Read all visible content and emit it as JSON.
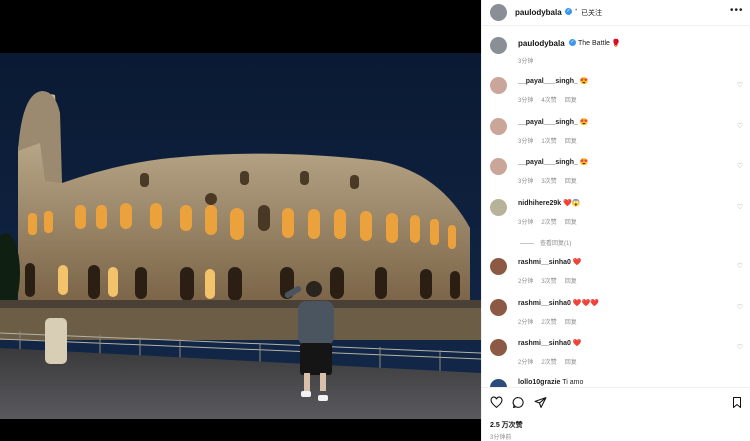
{
  "post": {
    "username": "paulodybala",
    "follow_status": "已关注",
    "more_label": "•••",
    "caption_user": "paulodybala",
    "caption_text": "The Battle 🥊",
    "caption_time": "3分钟"
  },
  "comments": [
    {
      "user": "__payal___singh_",
      "text": "😍",
      "time": "3分钟",
      "likes": "4次赞",
      "reply": "回复"
    },
    {
      "user": "__payal___singh_",
      "text": "😍",
      "time": "3分钟",
      "likes": "1次赞",
      "reply": "回复"
    },
    {
      "user": "__payal___singh_",
      "text": "😍",
      "time": "3分钟",
      "likes": "3次赞",
      "reply": "回复"
    },
    {
      "user": "nidhihere29k",
      "text": "❤️😱",
      "time": "3分钟",
      "likes": "2次赞",
      "reply": "回复",
      "view_replies": "查看回复(1)"
    },
    {
      "user": "rashmi__sinha0",
      "text": "❤️",
      "time": "2分钟",
      "likes": "3次赞",
      "reply": "回复"
    },
    {
      "user": "rashmi__sinha0",
      "text": "❤️❤️❤️",
      "time": "2分钟",
      "likes": "2次赞",
      "reply": "回复"
    },
    {
      "user": "rashmi__sinha0",
      "text": "❤️",
      "time": "2分钟",
      "likes": "2次赞",
      "reply": "回复"
    },
    {
      "user": "lollo10grazie",
      "text": "Ti amo",
      "time": "",
      "likes": "",
      "reply": ""
    }
  ],
  "actions": {
    "likes": "2.5 万次赞",
    "time_ago": "3分钟前"
  },
  "icons": [
    "heart-icon",
    "comment-icon",
    "share-icon",
    "bookmark-icon",
    "verified-icon",
    "more-icon"
  ],
  "colors": {
    "verified": "#3897f0",
    "heart_red": "#ed4956",
    "meta_gray": "#8e8e8e"
  }
}
